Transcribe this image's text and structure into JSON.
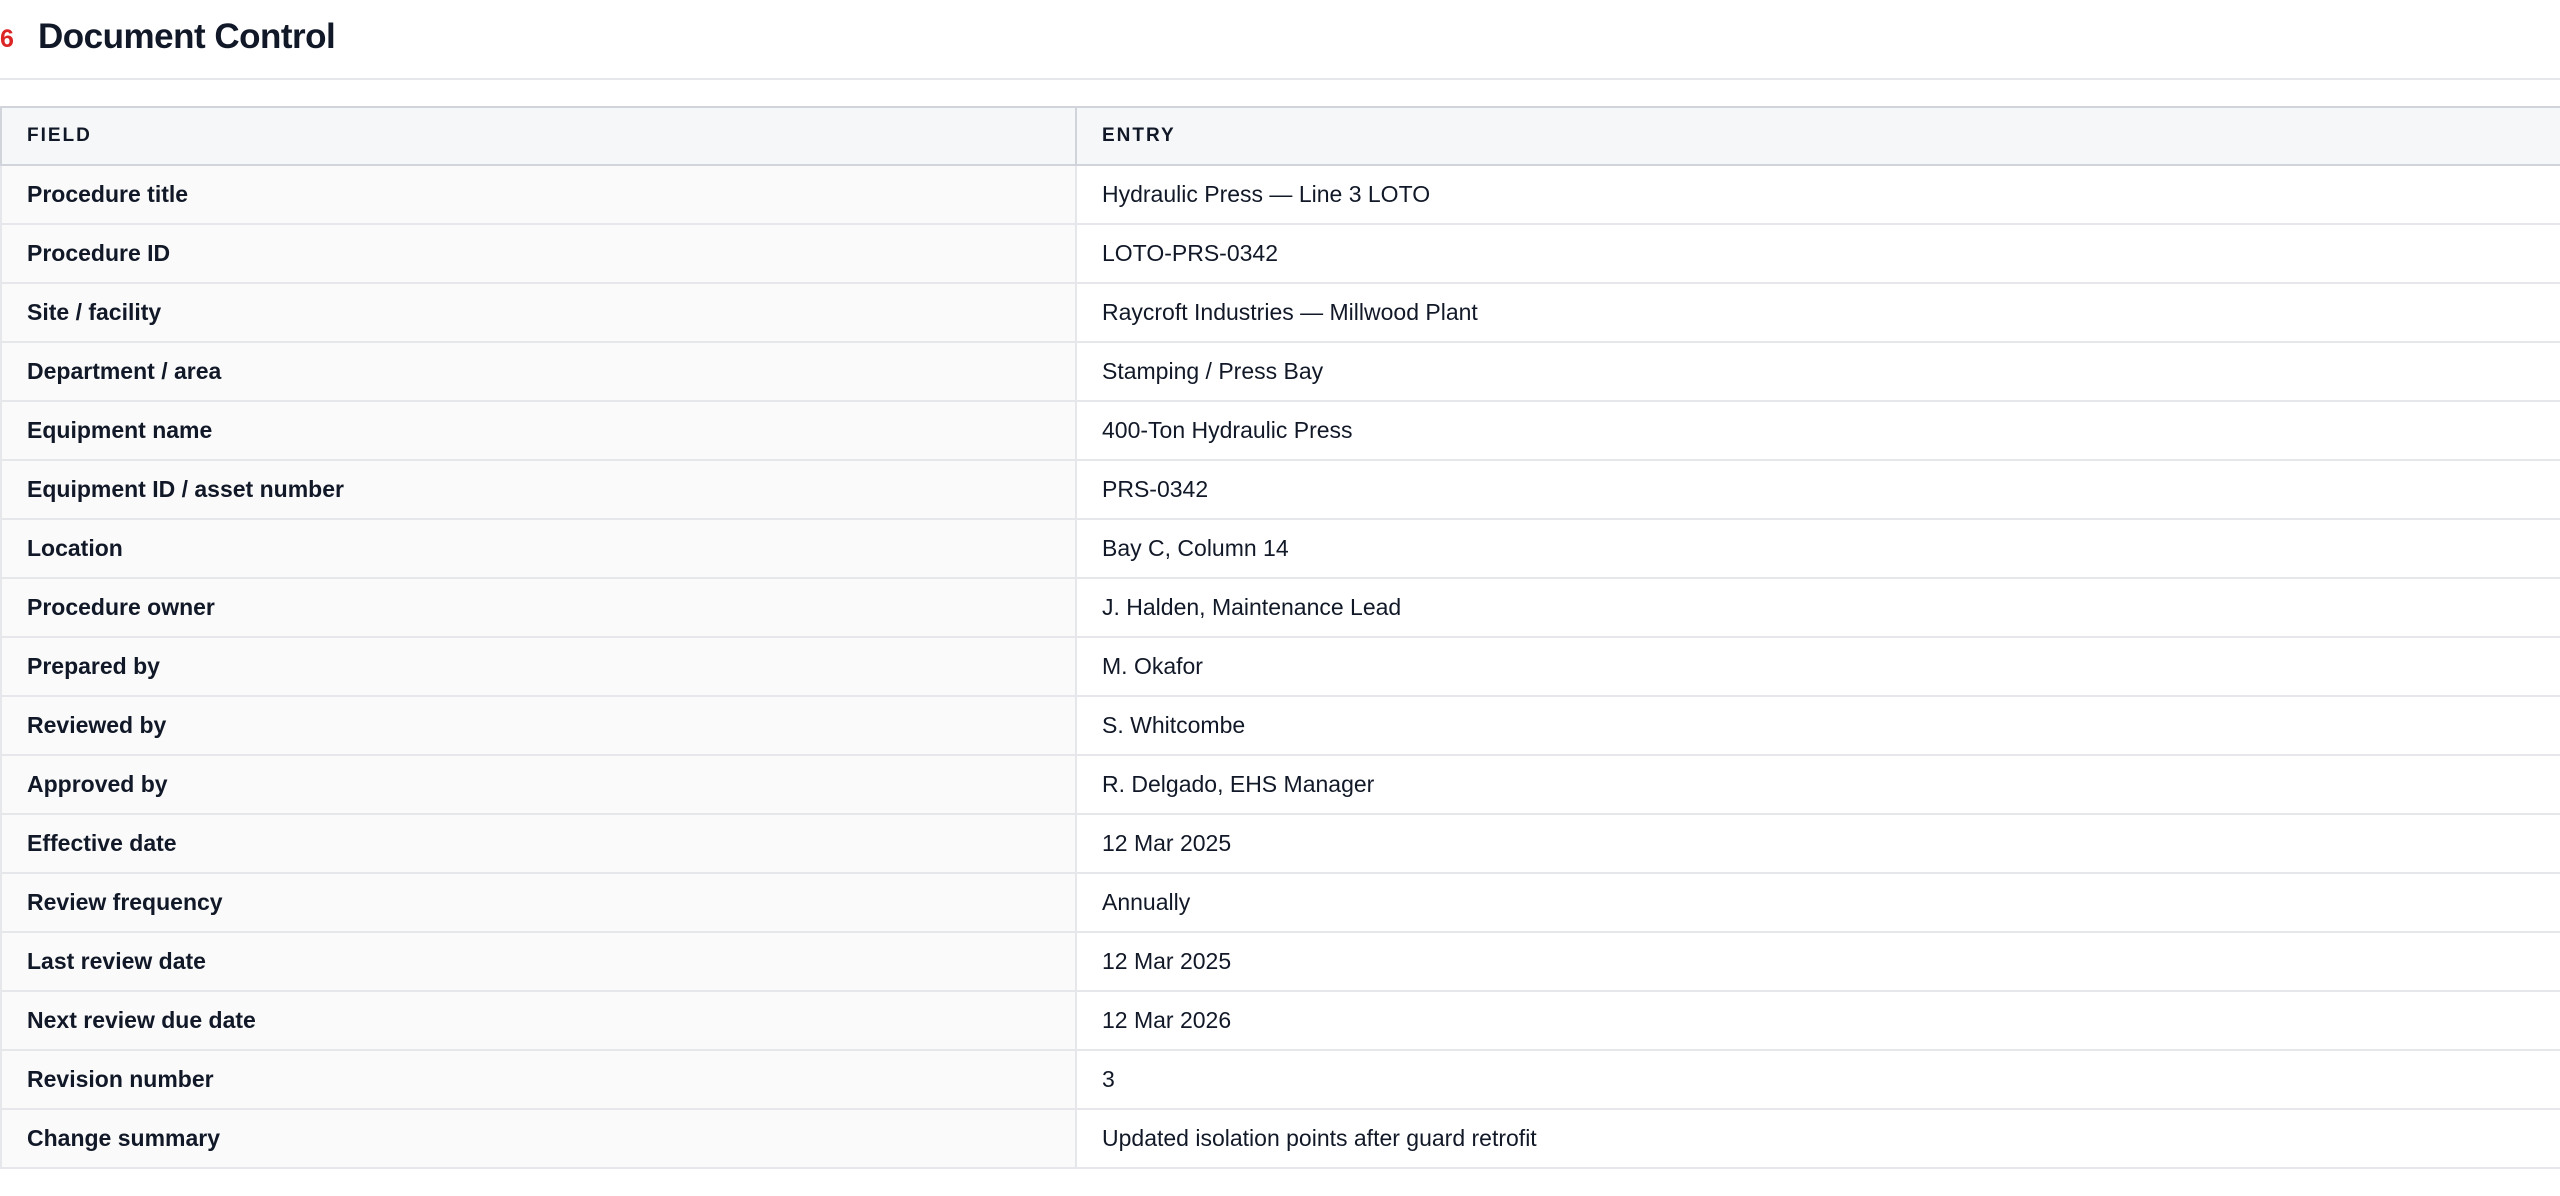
{
  "section": {
    "number": "6",
    "title": "Document Control"
  },
  "table": {
    "headers": [
      "FIELD",
      "ENTRY"
    ],
    "rows": [
      {
        "field": "Procedure title",
        "entry": "Hydraulic Press — Line 3 LOTO"
      },
      {
        "field": "Procedure ID",
        "entry": "LOTO-PRS-0342"
      },
      {
        "field": "Site / facility",
        "entry": "Raycroft Industries — Millwood Plant"
      },
      {
        "field": "Department / area",
        "entry": "Stamping / Press Bay"
      },
      {
        "field": "Equipment name",
        "entry": "400-Ton Hydraulic Press"
      },
      {
        "field": "Equipment ID / asset number",
        "entry": "PRS-0342"
      },
      {
        "field": "Location",
        "entry": "Bay C, Column 14"
      },
      {
        "field": "Procedure owner",
        "entry": "J. Halden, Maintenance Lead"
      },
      {
        "field": "Prepared by",
        "entry": "M. Okafor"
      },
      {
        "field": "Reviewed by",
        "entry": "S. Whitcombe"
      },
      {
        "field": "Approved by",
        "entry": "R. Delgado, EHS Manager"
      },
      {
        "field": "Effective date",
        "entry": "12 Mar 2025"
      },
      {
        "field": "Review frequency",
        "entry": "Annually"
      },
      {
        "field": "Last review date",
        "entry": "12 Mar 2025"
      },
      {
        "field": "Next review due date",
        "entry": "12 Mar 2026"
      },
      {
        "field": "Revision number",
        "entry": "3"
      },
      {
        "field": "Change summary",
        "entry": "Updated isolation points after guard retrofit"
      }
    ]
  }
}
